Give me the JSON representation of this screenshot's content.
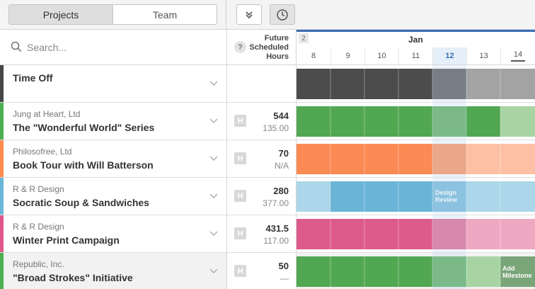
{
  "tabs": {
    "projects": "Projects",
    "team": "Team"
  },
  "toolbar": {
    "collapse_icon": "double-chevron-down-icon",
    "clock_icon": "clock-icon"
  },
  "search": {
    "placeholder": "Search..."
  },
  "hours_header": {
    "help": "?",
    "label_line1": "Future",
    "label_line2": "Scheduled",
    "label_line3": "Hours"
  },
  "timeline": {
    "week": "2",
    "month": "Jan",
    "days": [
      "8",
      "9",
      "10",
      "11",
      "12",
      "13",
      "14"
    ],
    "today": "12"
  },
  "rows": [
    {
      "client": "",
      "title": "Time Off",
      "scheduled": "",
      "hours": "",
      "h_badge": "",
      "color": "#474747"
    },
    {
      "client": "Jung at Heart, Ltd",
      "title": "The \"Wonderful World\" Series",
      "scheduled": "544",
      "hours": "135.00",
      "h_badge": "H",
      "color": "#4caf50"
    },
    {
      "client": "Philosofree, Ltd",
      "title": "Book Tour with Will Batterson",
      "scheduled": "70",
      "hours": "N/A",
      "h_badge": "H",
      "color": "#ff8a50"
    },
    {
      "client": "R & R Design",
      "title": "Socratic Soup & Sandwiches",
      "scheduled": "280",
      "hours": "377.00",
      "h_badge": "H",
      "color": "#6bb6d9"
    },
    {
      "client": "R & R Design",
      "title": "Winter Print Campaign",
      "scheduled": "431.5",
      "hours": "117.00",
      "h_badge": "H",
      "color": "#e0578a"
    },
    {
      "client": "Republic, Inc.",
      "title": "\"Broad Strokes\" Initiative",
      "scheduled": "50",
      "hours": "—",
      "h_badge": "H",
      "color": "#4caf50"
    }
  ],
  "milestones": {
    "design_review_1": "Design",
    "design_review_2": "Review",
    "add_milestone_1": "Add",
    "add_milestone_2": "Milestone"
  }
}
